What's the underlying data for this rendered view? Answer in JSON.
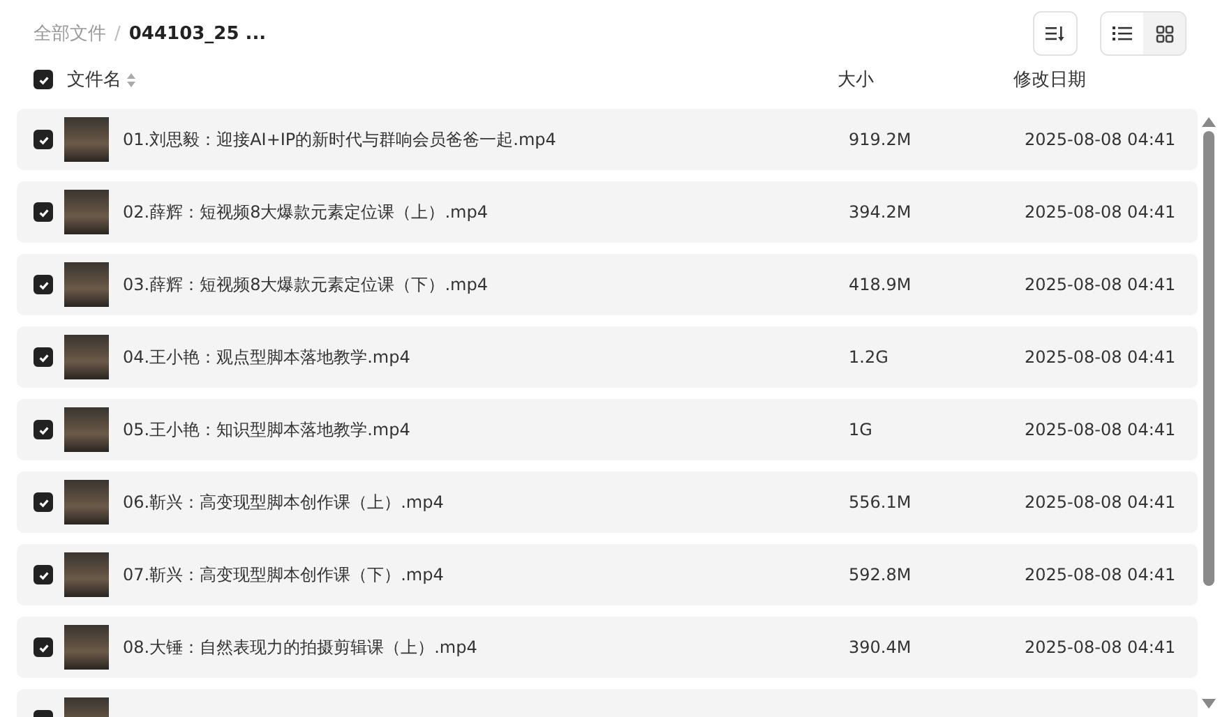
{
  "breadcrumb": {
    "root": "全部文件",
    "separator": "/",
    "current": "044103_25 ..."
  },
  "toolbar": {
    "view_modes": [
      {
        "kind": "list",
        "selected": true
      },
      {
        "kind": "grid",
        "selected": false
      }
    ]
  },
  "table": {
    "select_all": {
      "checked": true
    },
    "columns": [
      {
        "label": "文件名",
        "sortable": true
      },
      {
        "label": "大小",
        "sortable": false
      },
      {
        "label": "修改日期",
        "sortable": false
      }
    ],
    "rows": [
      {
        "name": "01.刘思毅：迎接AI+IP的新时代与群响会员爸爸一起.mp4",
        "size": "919.2M",
        "modified": "2025-08-08 04:41",
        "checked": true
      },
      {
        "name": "02.薛辉：短视频8大爆款元素定位课（上）.mp4",
        "size": "394.2M",
        "modified": "2025-08-08 04:41",
        "checked": true
      },
      {
        "name": "03.薛辉：短视频8大爆款元素定位课（下）.mp4",
        "size": "418.9M",
        "modified": "2025-08-08 04:41",
        "checked": true
      },
      {
        "name": "04.王小艳：观点型脚本落地教学.mp4",
        "size": "1.2G",
        "modified": "2025-08-08 04:41",
        "checked": true
      },
      {
        "name": "05.王小艳：知识型脚本落地教学.mp4",
        "size": "1G",
        "modified": "2025-08-08 04:41",
        "checked": true
      },
      {
        "name": "06.靳兴：高变现型脚本创作课（上）.mp4",
        "size": "556.1M",
        "modified": "2025-08-08 04:41",
        "checked": true
      },
      {
        "name": "07.靳兴：高变现型脚本创作课（下）.mp4",
        "size": "592.8M",
        "modified": "2025-08-08 04:41",
        "checked": true
      },
      {
        "name": "08.大锤：自然表现力的拍摄剪辑课（上）.mp4",
        "size": "390.4M",
        "modified": "2025-08-08 04:41",
        "checked": true
      },
      {
        "checked": true
      }
    ]
  }
}
